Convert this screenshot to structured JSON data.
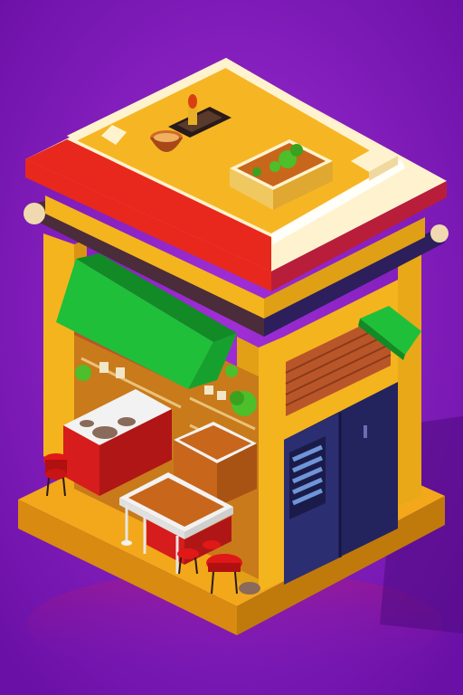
{
  "scene": {
    "subject": "isometric-street-food-stall",
    "colors": {
      "background": "#7a16b8",
      "background_glow": "#9b2ad0",
      "base_platform": "#f2a81a",
      "base_side": "#d98a10",
      "walls": "#f4b41e",
      "wall_shadow": "#d99414",
      "roof_red": "#e8281c",
      "roof_trim": "#fff3cf",
      "roof_top": "#f6b624",
      "dark_beam": "#4a2c3a",
      "awning_green": "#1fbf3a",
      "awning_dark": "#128a26",
      "counter_red": "#d61c1c",
      "counter_top": "#f2f2f2",
      "tray_orange": "#c8661c",
      "door_navy": "#23245e",
      "window_blue": "#5a82c8",
      "stool_red": "#e01818",
      "herb_green": "#4cbf2a",
      "brick": "#b8562a"
    },
    "elements": [
      "base-platform",
      "stall-walls",
      "red-roof",
      "rooftop-planter",
      "rooftop-bowl",
      "green-awning",
      "side-awning",
      "serving-counter",
      "front-food-cart",
      "brick-wall",
      "navy-door",
      "vent-window",
      "red-stools"
    ]
  }
}
